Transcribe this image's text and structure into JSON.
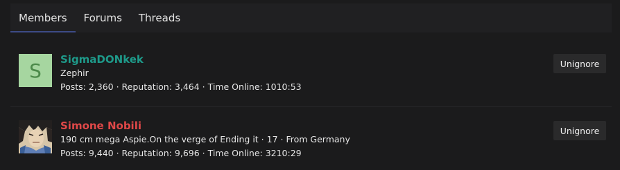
{
  "tabs": [
    {
      "label": "Members"
    },
    {
      "label": "Forums"
    },
    {
      "label": "Threads"
    }
  ],
  "members": [
    {
      "username": "SigmaDONkek",
      "username_color": "#1e9a8a",
      "avatar_letter": "S",
      "title": "Zephir",
      "stats": "Posts: 2,360 · Reputation: 3,464 · Time Online: 1010:53",
      "button_label": "Unignore"
    },
    {
      "username": "Simone Nobili",
      "username_color": "#e04848",
      "title": "190 cm mega Aspie.On the verge of Ending it · 17 · From Germany",
      "stats": "Posts: 9,440 · Reputation: 9,696 · Time Online: 3210:29",
      "button_label": "Unignore"
    }
  ],
  "colors": {
    "background": "#1b1b1c",
    "tab_bar": "#202022",
    "active_tab_underline": "#3d4b86",
    "button_bg": "#2a2a2b",
    "avatar_bg": "#a6d6a0"
  }
}
